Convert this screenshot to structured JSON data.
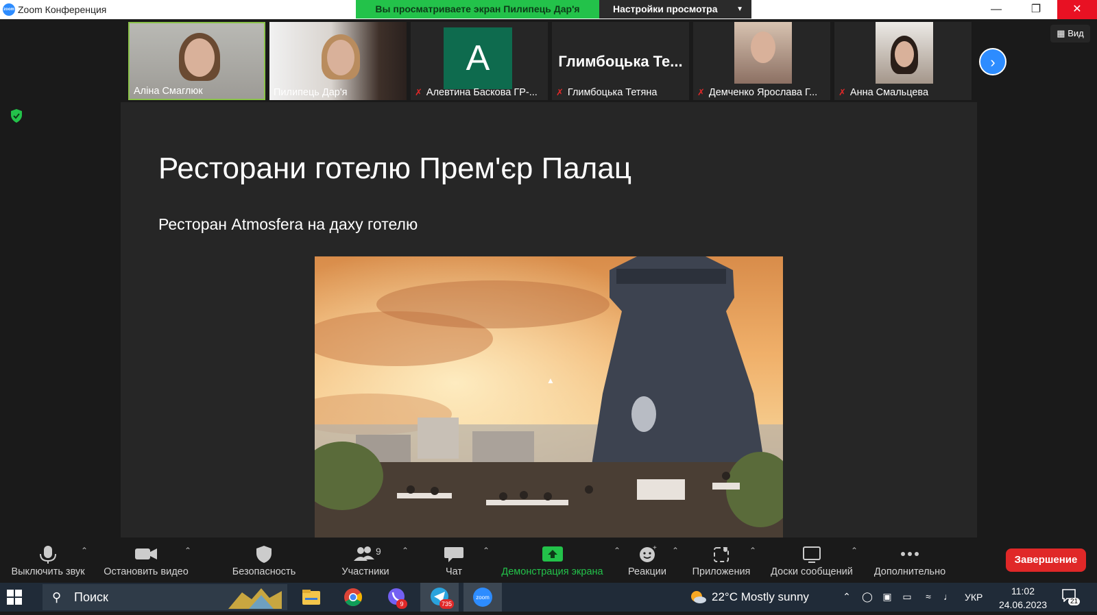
{
  "window": {
    "title": "Zoom Конференция",
    "logo_text": "zoom",
    "share_banner": "Вы просматриваете экран Пилипець Дар'я",
    "view_settings": "Настройки просмотра"
  },
  "participants": [
    {
      "name": "Аліна Смаглюк",
      "muted": false,
      "active": true
    },
    {
      "name": "Пилипець Дар'я",
      "muted": false,
      "active": false
    },
    {
      "name": "Алевтина Баскова ГР-...",
      "muted": true,
      "avatar_letter": "A"
    },
    {
      "name": "Глимбоцька Тетяна",
      "muted": true,
      "big_name": "Глимбоцька  Те..."
    },
    {
      "name": "Демченко Ярослава Г...",
      "muted": true
    },
    {
      "name": "Анна Смальцева",
      "muted": true
    }
  ],
  "view_button": "Вид",
  "slide": {
    "title": "Ресторани готелю Прем'єр Палац",
    "subtitle": "Ресторан Atmosfera на даху готелю"
  },
  "toolbar": {
    "mute": "Выключить звук",
    "video": "Остановить видео",
    "security": "Безопасность",
    "participants": "Участники",
    "participants_count": "9",
    "chat": "Чат",
    "share": "Демонстрация экрана",
    "reactions": "Реакции",
    "apps": "Приложения",
    "whiteboards": "Доски сообщений",
    "more": "Дополнительно",
    "end": "Завершение"
  },
  "taskbar": {
    "search_placeholder": "Поиск",
    "viber_badge": "9",
    "telegram_badge": "735",
    "zoom_label": "zoom",
    "weather": "22°C  Mostly sunny",
    "language": "УКР",
    "time": "11:02",
    "date": "24.06.2023",
    "notifications": "21"
  },
  "colors": {
    "zoom_blue": "#2D8CFF",
    "share_green": "#23c24a",
    "end_red": "#e02828",
    "background": "#1a1a1a"
  }
}
